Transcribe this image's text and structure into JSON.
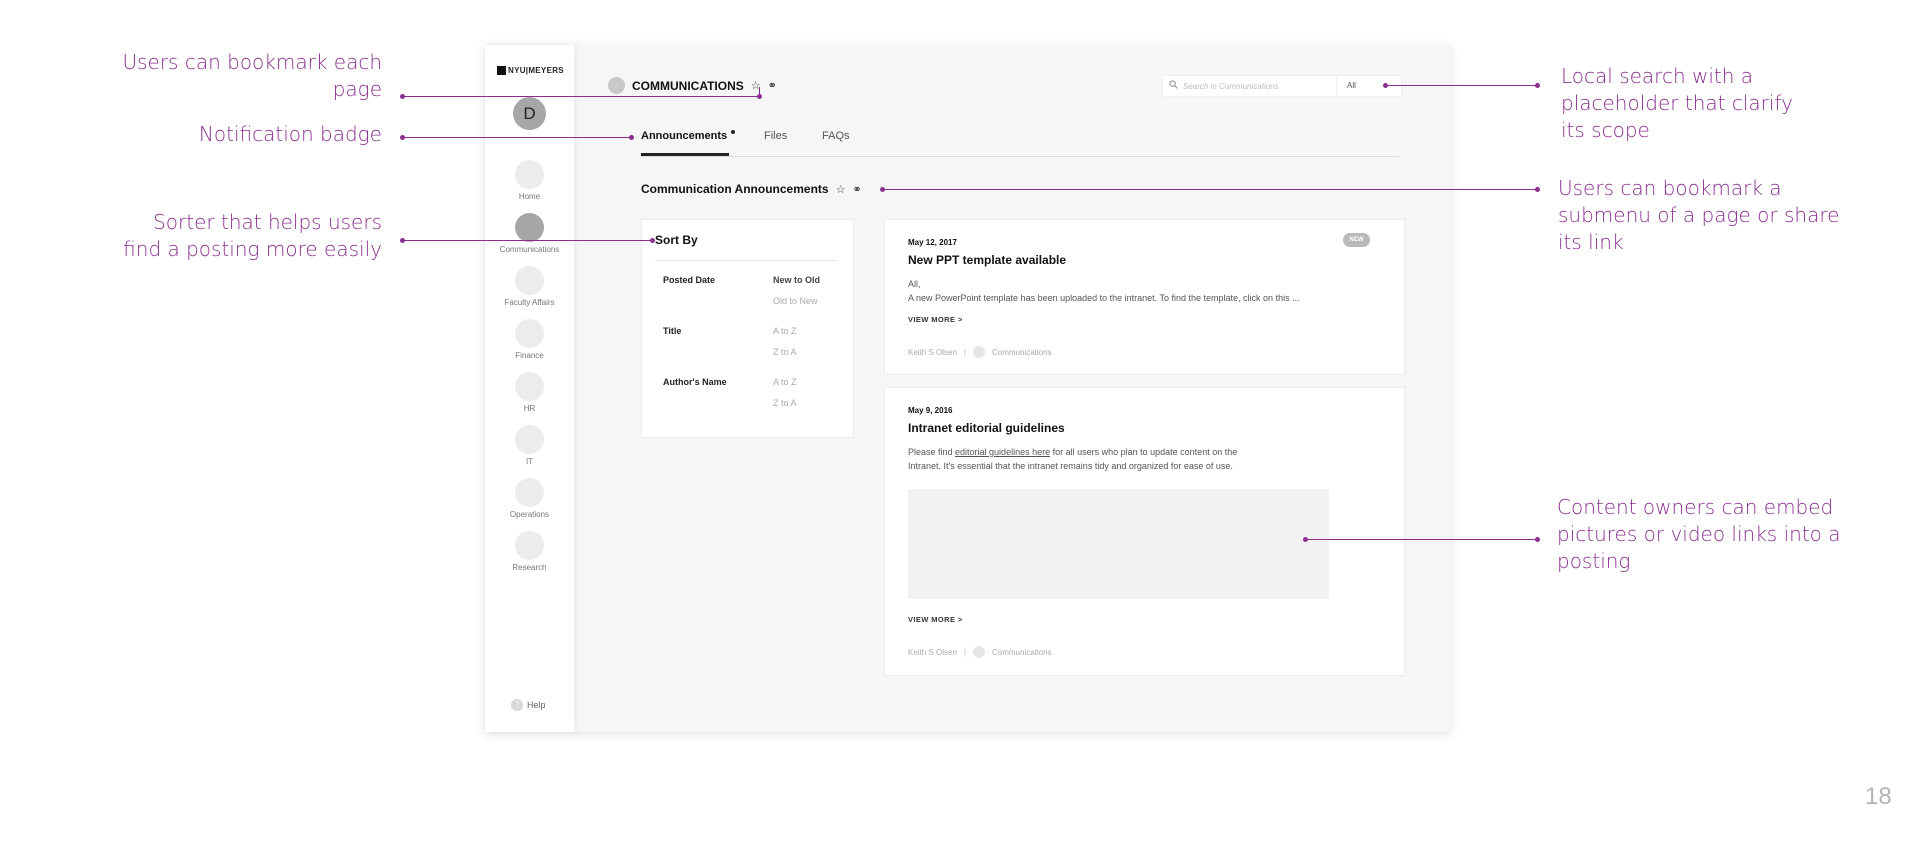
{
  "annotations": {
    "bookmark_page": "Users can  bookmark each page",
    "notification_badge": "Notification badge",
    "sorter": "Sorter that helps users find a posting more easily",
    "local_search": "Local search with a placeholder that clarify its scope",
    "bookmark_submenu": "Users can bookmark a submenu of a page or share its link",
    "embed_media": "Content owners can embed pictures or video links into a posting"
  },
  "logo": {
    "text": "NYU|MEYERS"
  },
  "user": {
    "initial": "D"
  },
  "sidebar": {
    "items": [
      {
        "label": "Home"
      },
      {
        "label": "Communications",
        "active": true
      },
      {
        "label": "Faculty Affairs"
      },
      {
        "label": "Finance"
      },
      {
        "label": "HR"
      },
      {
        "label": "IT"
      },
      {
        "label": "Operations"
      },
      {
        "label": "Research"
      }
    ],
    "help_label": "Help",
    "help_glyph": "?"
  },
  "header": {
    "title": "COMMUNICATIONS",
    "star_icon": "☆",
    "link_icon": "⚭",
    "search": {
      "placeholder": "Search in Communications",
      "scope": "All",
      "icon": "search-icon"
    }
  },
  "tabs": [
    {
      "label": "Announcements",
      "active": true,
      "has_notification": true
    },
    {
      "label": "Files"
    },
    {
      "label": "FAQs"
    }
  ],
  "section": {
    "title": "Communication Announcements"
  },
  "sort": {
    "heading": "Sort By",
    "groups": [
      {
        "label": "Posted Date",
        "options": [
          "New to Old",
          "Old to New"
        ],
        "selected": "New to Old"
      },
      {
        "label": "Title",
        "options": [
          "A to Z",
          "Z to A"
        ]
      },
      {
        "label": "Author's Name",
        "options": [
          "A to Z",
          "Z to A"
        ]
      }
    ]
  },
  "posts": [
    {
      "date": "May 12, 2017",
      "title": "New PPT template available",
      "badge": "NEW",
      "greeting": "All,",
      "body": "A new PowerPoint template has been uploaded to the intranet. To find the template, click on this ...",
      "view_more": "VIEW MORE >",
      "author": "Keith S Olsen",
      "department": "Communications",
      "separator": "|"
    },
    {
      "date": "May 9, 2016",
      "title": "Intranet editorial guidelines",
      "body_pre": "Please find ",
      "body_link": "editorial guidelines here",
      "body_post": " for all users who plan to update content on the",
      "body_line2": "Intranet. It's essential that the intranet remains tidy and organized for ease of use.",
      "view_more": "VIEW MORE >",
      "author": "Keith S Olsen",
      "department": "Communications",
      "separator": "|"
    }
  ],
  "slide_number": "18",
  "colors": {
    "annotation": "#8a2f8f",
    "active_nav": "#a6a6a6",
    "background": "#f6f6f6"
  }
}
